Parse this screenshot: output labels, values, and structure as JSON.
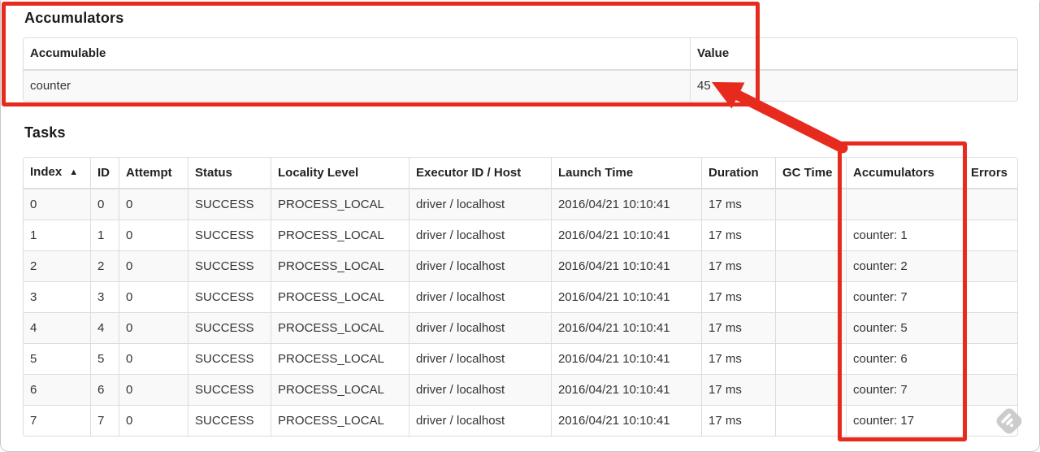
{
  "annotation_color": "#e62b1e",
  "accumulators_section": {
    "title": "Accumulators",
    "table": {
      "headers": [
        "Accumulable",
        "Value"
      ],
      "rows": [
        {
          "accumulable": "counter",
          "value": "45"
        }
      ]
    }
  },
  "tasks_section": {
    "title": "Tasks",
    "table": {
      "headers": [
        "Index",
        "ID",
        "Attempt",
        "Status",
        "Locality Level",
        "Executor ID / Host",
        "Launch Time",
        "Duration",
        "GC Time",
        "Accumulators",
        "Errors"
      ],
      "sort_icon": "▲",
      "sorted_column": "Index",
      "rows": [
        {
          "index": "0",
          "id": "0",
          "attempt": "0",
          "status": "SUCCESS",
          "locality_level": "PROCESS_LOCAL",
          "executor_id_host": "driver / localhost",
          "launch_time": "2016/04/21 10:10:41",
          "duration": "17 ms",
          "gc_time": "",
          "accumulators": "",
          "errors": ""
        },
        {
          "index": "1",
          "id": "1",
          "attempt": "0",
          "status": "SUCCESS",
          "locality_level": "PROCESS_LOCAL",
          "executor_id_host": "driver / localhost",
          "launch_time": "2016/04/21 10:10:41",
          "duration": "17 ms",
          "gc_time": "",
          "accumulators": "counter: 1",
          "errors": ""
        },
        {
          "index": "2",
          "id": "2",
          "attempt": "0",
          "status": "SUCCESS",
          "locality_level": "PROCESS_LOCAL",
          "executor_id_host": "driver / localhost",
          "launch_time": "2016/04/21 10:10:41",
          "duration": "17 ms",
          "gc_time": "",
          "accumulators": "counter: 2",
          "errors": ""
        },
        {
          "index": "3",
          "id": "3",
          "attempt": "0",
          "status": "SUCCESS",
          "locality_level": "PROCESS_LOCAL",
          "executor_id_host": "driver / localhost",
          "launch_time": "2016/04/21 10:10:41",
          "duration": "17 ms",
          "gc_time": "",
          "accumulators": "counter: 7",
          "errors": ""
        },
        {
          "index": "4",
          "id": "4",
          "attempt": "0",
          "status": "SUCCESS",
          "locality_level": "PROCESS_LOCAL",
          "executor_id_host": "driver / localhost",
          "launch_time": "2016/04/21 10:10:41",
          "duration": "17 ms",
          "gc_time": "",
          "accumulators": "counter: 5",
          "errors": ""
        },
        {
          "index": "5",
          "id": "5",
          "attempt": "0",
          "status": "SUCCESS",
          "locality_level": "PROCESS_LOCAL",
          "executor_id_host": "driver / localhost",
          "launch_time": "2016/04/21 10:10:41",
          "duration": "17 ms",
          "gc_time": "",
          "accumulators": "counter: 6",
          "errors": ""
        },
        {
          "index": "6",
          "id": "6",
          "attempt": "0",
          "status": "SUCCESS",
          "locality_level": "PROCESS_LOCAL",
          "executor_id_host": "driver / localhost",
          "launch_time": "2016/04/21 10:10:41",
          "duration": "17 ms",
          "gc_time": "",
          "accumulators": "counter: 7",
          "errors": ""
        },
        {
          "index": "7",
          "id": "7",
          "attempt": "0",
          "status": "SUCCESS",
          "locality_level": "PROCESS_LOCAL",
          "executor_id_host": "driver / localhost",
          "launch_time": "2016/04/21 10:10:41",
          "duration": "17 ms",
          "gc_time": "",
          "accumulators": "counter: 17",
          "errors": ""
        }
      ]
    }
  }
}
